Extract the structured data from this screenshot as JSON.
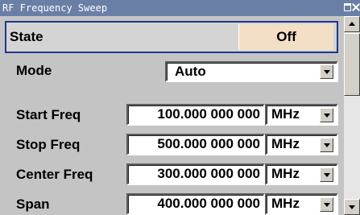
{
  "window": {
    "title": "RF Frequency Sweep"
  },
  "state": {
    "label": "State",
    "value": "Off"
  },
  "mode": {
    "label": "Mode",
    "value": "Auto"
  },
  "rows": [
    {
      "label": "Start Freq",
      "value": "100.000 000 000",
      "unit": "MHz"
    },
    {
      "label": "Stop Freq",
      "value": "500.000 000 000",
      "unit": "MHz"
    },
    {
      "label": "Center Freq",
      "value": "300.000 000 000",
      "unit": "MHz"
    },
    {
      "label": "Span",
      "value": "400.000 000 000",
      "unit": "MHz"
    }
  ],
  "colors": {
    "titlebar": "#6a7fa6",
    "focus_border": "#20368c",
    "state_button": "#f3dfc6",
    "panel": "#c4c4c4"
  },
  "icons": [
    "maximize-icon",
    "close-icon",
    "dropdown-arrow-icon",
    "scroll-up-icon",
    "scroll-down-icon"
  ]
}
